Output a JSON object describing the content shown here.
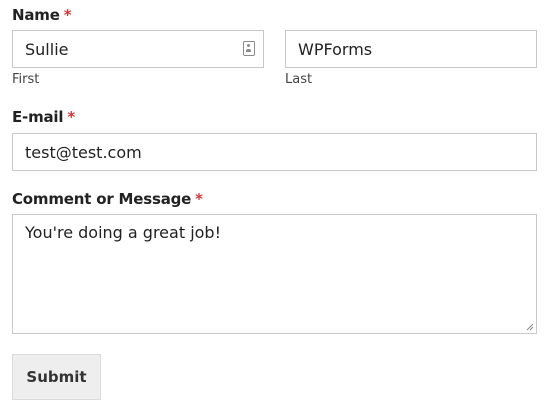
{
  "name": {
    "label": "Name",
    "required_mark": "*",
    "first": {
      "value": "Sullie",
      "sublabel": "First",
      "icon": "contact-card-icon"
    },
    "last": {
      "value": "WPForms",
      "sublabel": "Last"
    }
  },
  "email": {
    "label": "E-mail",
    "required_mark": "*",
    "value": "test@test.com"
  },
  "message": {
    "label": "Comment or Message",
    "required_mark": "*",
    "value": "You're doing a great job!"
  },
  "submit": {
    "label": "Submit"
  },
  "colors": {
    "required": "#d63638",
    "border": "#c9c9c9",
    "button_bg": "#eeeeee"
  }
}
